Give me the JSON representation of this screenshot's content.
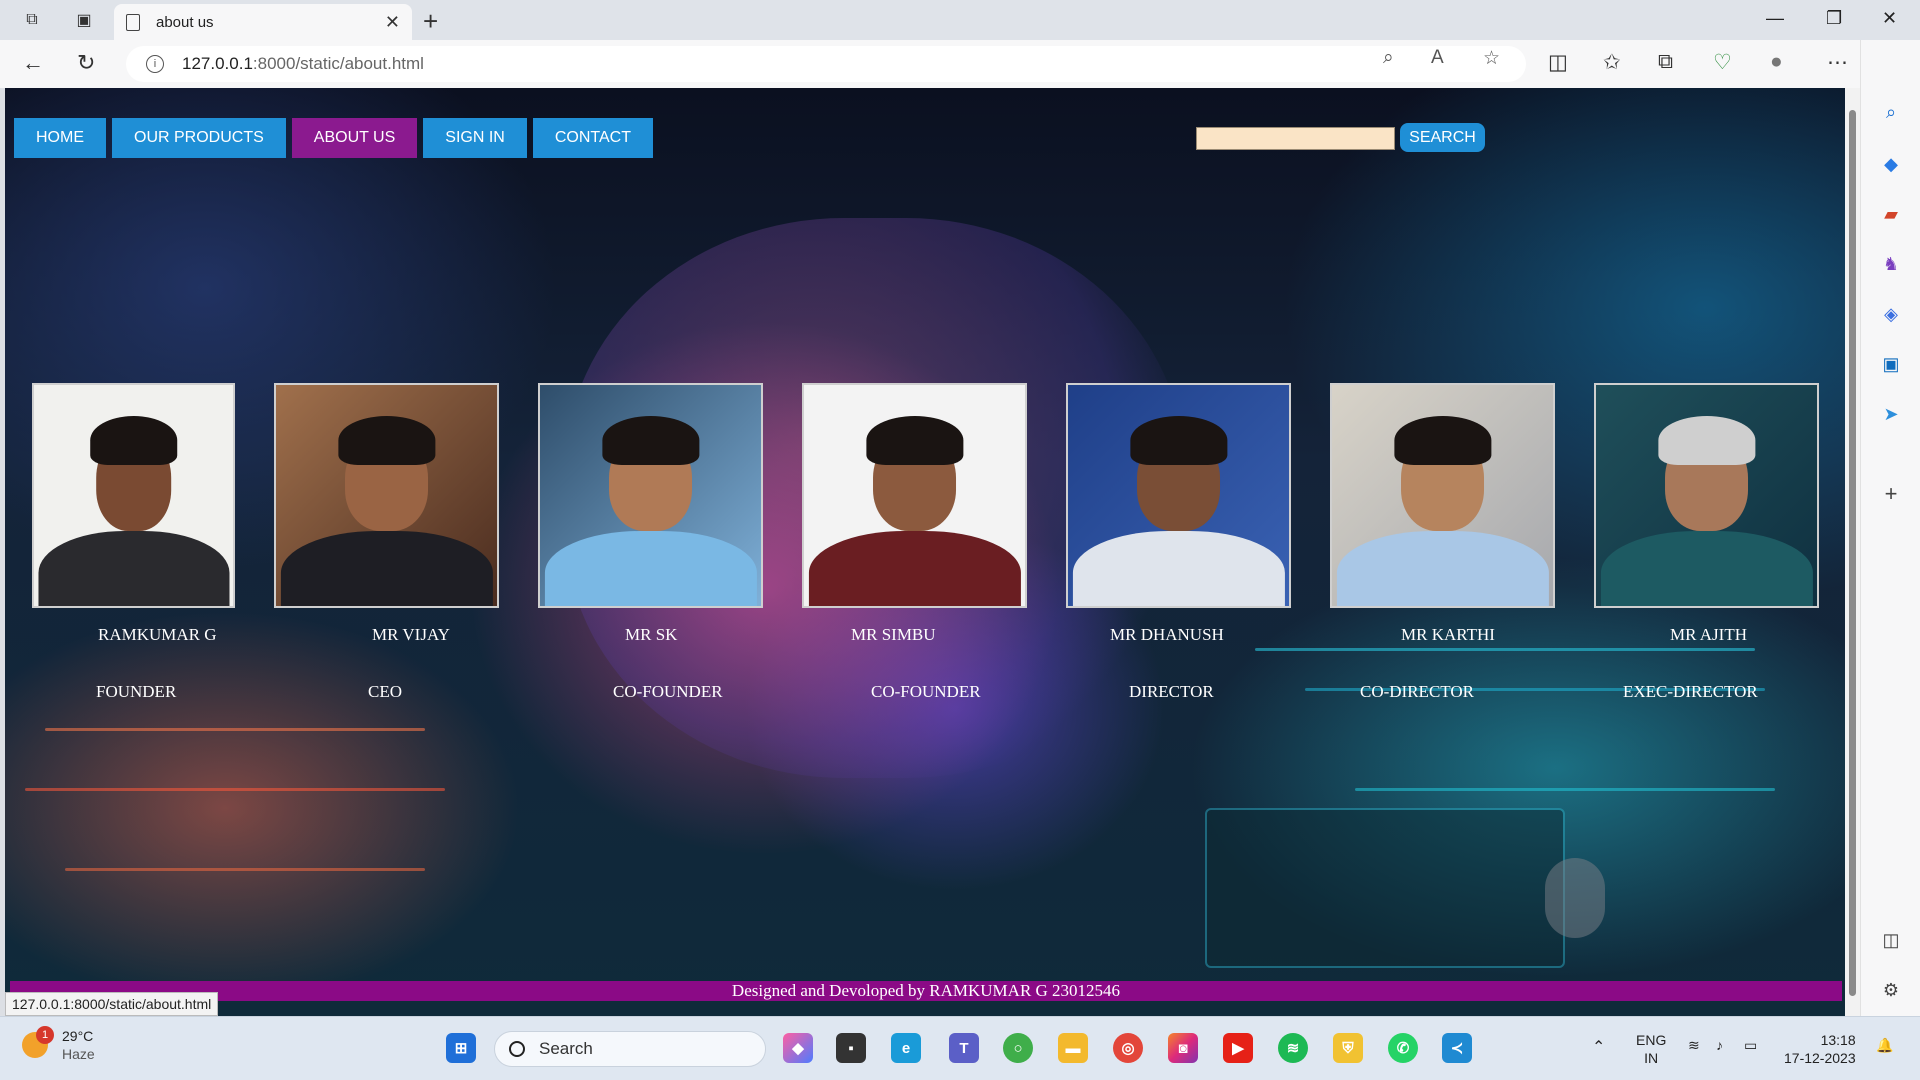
{
  "browser": {
    "tab_title": "about us",
    "url_host": "127.0.0.1",
    "url_rest": ":8000/static/about.html",
    "status_url": "127.0.0.1:8000/static/about.html"
  },
  "nav": {
    "items": [
      {
        "label": "HOME",
        "active": false
      },
      {
        "label": "OUR PRODUCTS",
        "active": false
      },
      {
        "label": "ABOUT US",
        "active": true
      },
      {
        "label": "SIGN IN",
        "active": false
      },
      {
        "label": "CONTACT",
        "active": false
      }
    ]
  },
  "search": {
    "placeholder": "",
    "button_label": "SEARCH"
  },
  "team": [
    {
      "name": "RAMKUMAR G",
      "role": "FOUNDER"
    },
    {
      "name": "MR VIJAY",
      "role": "CEO"
    },
    {
      "name": "MR SK",
      "role": "CO-FOUNDER"
    },
    {
      "name": "MR SIMBU",
      "role": "CO-FOUNDER"
    },
    {
      "name": "MR DHANUSH",
      "role": "DIRECTOR"
    },
    {
      "name": "MR KARTHI",
      "role": "CO-DIRECTOR"
    },
    {
      "name": "MR AJITH",
      "role": "EXEC-DIRECTOR"
    }
  ],
  "footer": {
    "text": "Designed and Devoloped by RAMKUMAR G 23012546"
  },
  "taskbar": {
    "weather_temp": "29°C",
    "weather_desc": "Haze",
    "weather_badge": "1",
    "search_label": "Search",
    "lang_top": "ENG",
    "lang_bottom": "IN",
    "time": "13:18",
    "date": "17-12-2023"
  },
  "colors": {
    "nav_blue": "#1f8fd6",
    "nav_active": "#8b1a8f",
    "footer_bg": "#8b0a86"
  }
}
